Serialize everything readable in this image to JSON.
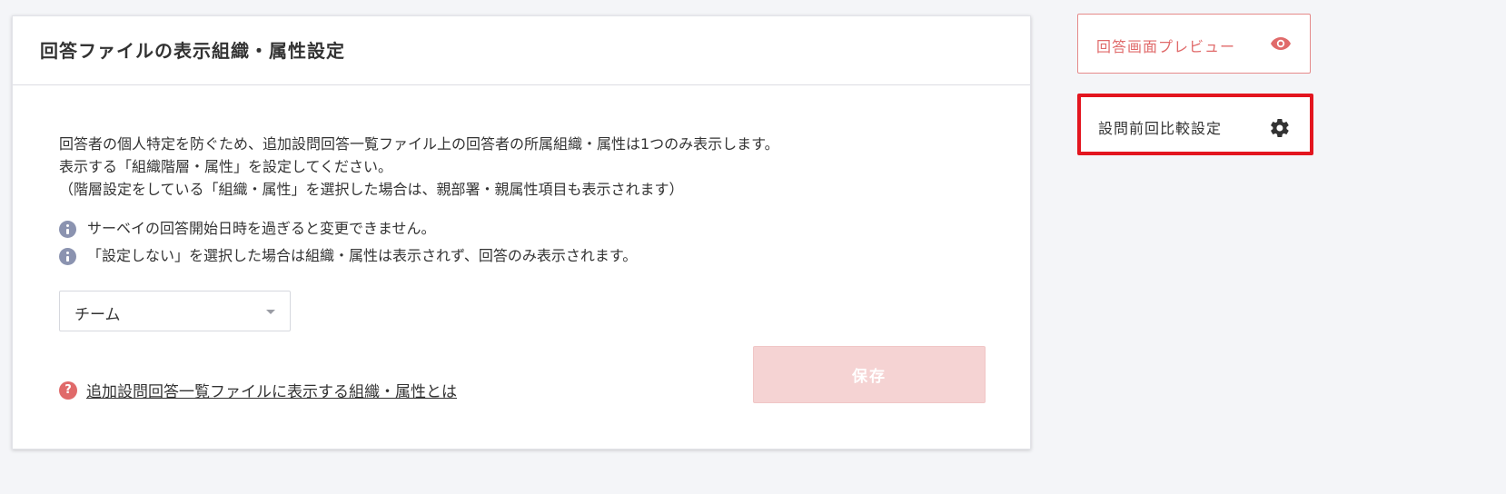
{
  "card": {
    "title": "回答ファイルの表示組織・属性設定",
    "description": [
      "回答者の個人特定を防ぐため、追加設問回答一覧ファイル上の回答者の所属組織・属性は1つのみ表示します。",
      "表示する「組織階層・属性」を設定してください。",
      "（階層設定をしている「組織・属性」を選択した場合は、親部署・親属性項目も表示されます）"
    ],
    "notes": [
      "サーベイの回答開始日時を過ぎると変更できません。",
      "「設定しない」を選択した場合は組織・属性は表示されず、回答のみ表示されます。"
    ],
    "select": {
      "value": "チーム"
    },
    "help": {
      "icon": "?",
      "link_text": "追加設問回答一覧ファイルに表示する組織・属性とは"
    },
    "save_label": "保存"
  },
  "sidebar": {
    "preview_label": "回答画面プレビュー",
    "compare_label": "設問前回比較設定"
  },
  "colors": {
    "accent": "#e06a6a",
    "save_disabled": "#f5d3d3",
    "highlight_border": "#e3151f",
    "info_icon": "#8b93b0"
  },
  "icons": {
    "preview": "eye-icon",
    "compare": "gear-icon",
    "note": "info-icon",
    "help": "question-icon"
  }
}
